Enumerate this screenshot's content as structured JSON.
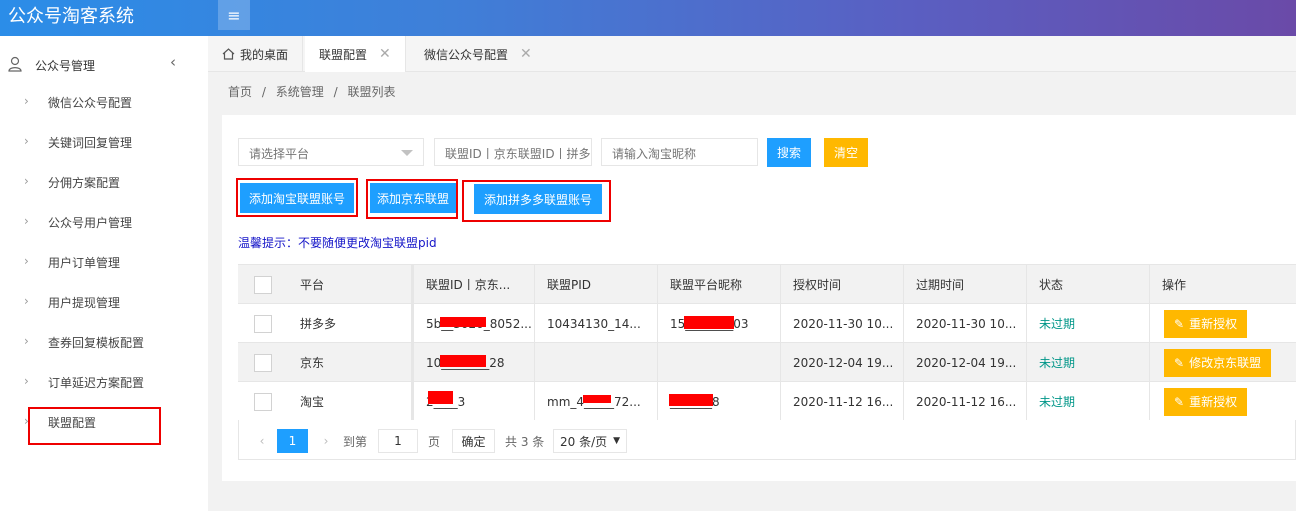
{
  "app": {
    "title": "公众号淘客系统",
    "menu_icon": "≡"
  },
  "sidebar": {
    "group_label": "公众号管理",
    "items": [
      {
        "label": "微信公众号配置"
      },
      {
        "label": "关键词回复管理"
      },
      {
        "label": "分佣方案配置"
      },
      {
        "label": "公众号用户管理"
      },
      {
        "label": "用户订单管理"
      },
      {
        "label": "用户提现管理"
      },
      {
        "label": "查券回复模板配置"
      },
      {
        "label": "订单延迟方案配置"
      },
      {
        "label": "联盟配置"
      }
    ]
  },
  "tabs": [
    {
      "label": "我的桌面"
    },
    {
      "label": "联盟配置"
    },
    {
      "label": "微信公众号配置"
    }
  ],
  "breadcrumb": {
    "home": "首页",
    "sep": "/",
    "system": "系统管理",
    "current": "联盟列表"
  },
  "search": {
    "platform_placeholder": "请选择平台",
    "id_placeholder": "联盟ID丨京东联盟ID丨拼多多ID",
    "nick_placeholder": "请输入淘宝昵称",
    "search_label": "搜索",
    "clear_label": "清空"
  },
  "actions": {
    "add_taobao": "添加淘宝联盟账号",
    "add_jd": "添加京东联盟",
    "add_pdd": "添加拼多多联盟账号"
  },
  "tip": "温馨提示：不要随便更改淘宝联盟pid",
  "table": {
    "headers": [
      "平台",
      "联盟ID丨京东...",
      "联盟PID",
      "联盟平台昵称",
      "授权时间",
      "过期时间",
      "状态",
      "操作"
    ],
    "rows": [
      {
        "platform": "拼多多",
        "union_id": "5b__3020_8052...",
        "pid": "10434130_14...",
        "nick": "15________03",
        "auth_time": "2020-11-30 10...",
        "expire_time": "2020-11-30 10...",
        "status": "未过期",
        "op": "重新授权"
      },
      {
        "platform": "京东",
        "union_id": "10________28",
        "pid": "",
        "nick": "",
        "auth_time": "2020-12-04 19...",
        "expire_time": "2020-12-04 19...",
        "status": "未过期",
        "op": "修改京东联盟"
      },
      {
        "platform": "淘宝",
        "union_id": "2____3",
        "pid": "mm_4_____72...",
        "nick": "_______8",
        "auth_time": "2020-11-12 16...",
        "expire_time": "2020-11-12 16...",
        "status": "未过期",
        "op": "重新授权"
      }
    ]
  },
  "pagination": {
    "current": "1",
    "goto_label": "到第",
    "goto_value": "1",
    "page_unit": "页",
    "confirm": "确定",
    "total": "共 3 条",
    "per_page": "20 条/页"
  },
  "colors": {
    "primary": "#1e9fff",
    "warning": "#ffb800",
    "status_ok": "#009688",
    "highlight": "#e00000"
  }
}
